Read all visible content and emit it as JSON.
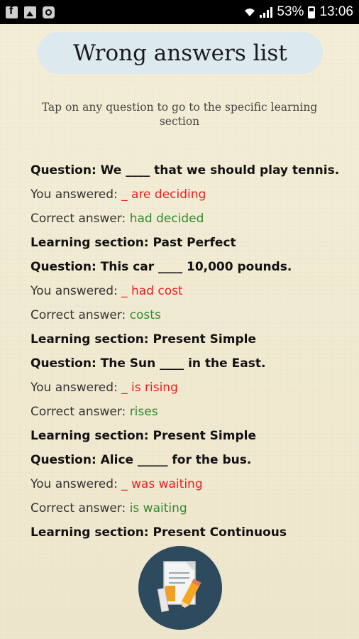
{
  "status_bar": {
    "left_icons": [
      "facebook-icon",
      "gallery-icon",
      "app-icon"
    ],
    "battery": "53%",
    "time": "13:06"
  },
  "header": {
    "title": "Wrong answers list",
    "hint": "Tap on any question to go to the specific learning section"
  },
  "colors": {
    "wrong": "#e82020",
    "correct": "#2f8a2f",
    "pill": "#dce9ef",
    "fab": "#2d4a5e"
  },
  "items": [
    {
      "question": "Question: We ____ that we should play tennis.",
      "answered_label": "You answered: ",
      "answered": "_ are deciding",
      "correct_label": "Correct answer: ",
      "correct": "had decided",
      "section": "Learning section: Past Perfect"
    },
    {
      "question": "Question: This car ____ 10,000 pounds.",
      "answered_label": "You answered: ",
      "answered": "_ had cost",
      "correct_label": "Correct answer: ",
      "correct": "costs",
      "section": "Learning section: Present Simple"
    },
    {
      "question": "Question: The Sun ____ in the East.",
      "answered_label": "You answered: ",
      "answered": "_ is rising",
      "correct_label": "Correct answer: ",
      "correct": "rises",
      "section": "Learning section: Present Simple"
    },
    {
      "question": "Question: Alice _____ for the bus.",
      "answered_label": "You answered: ",
      "answered": "_ was waiting",
      "correct_label": "Correct answer: ",
      "correct": "is waiting",
      "section": "Learning section: Present Continuous"
    }
  ],
  "fab": {
    "icon": "notes-pencil-icon"
  }
}
